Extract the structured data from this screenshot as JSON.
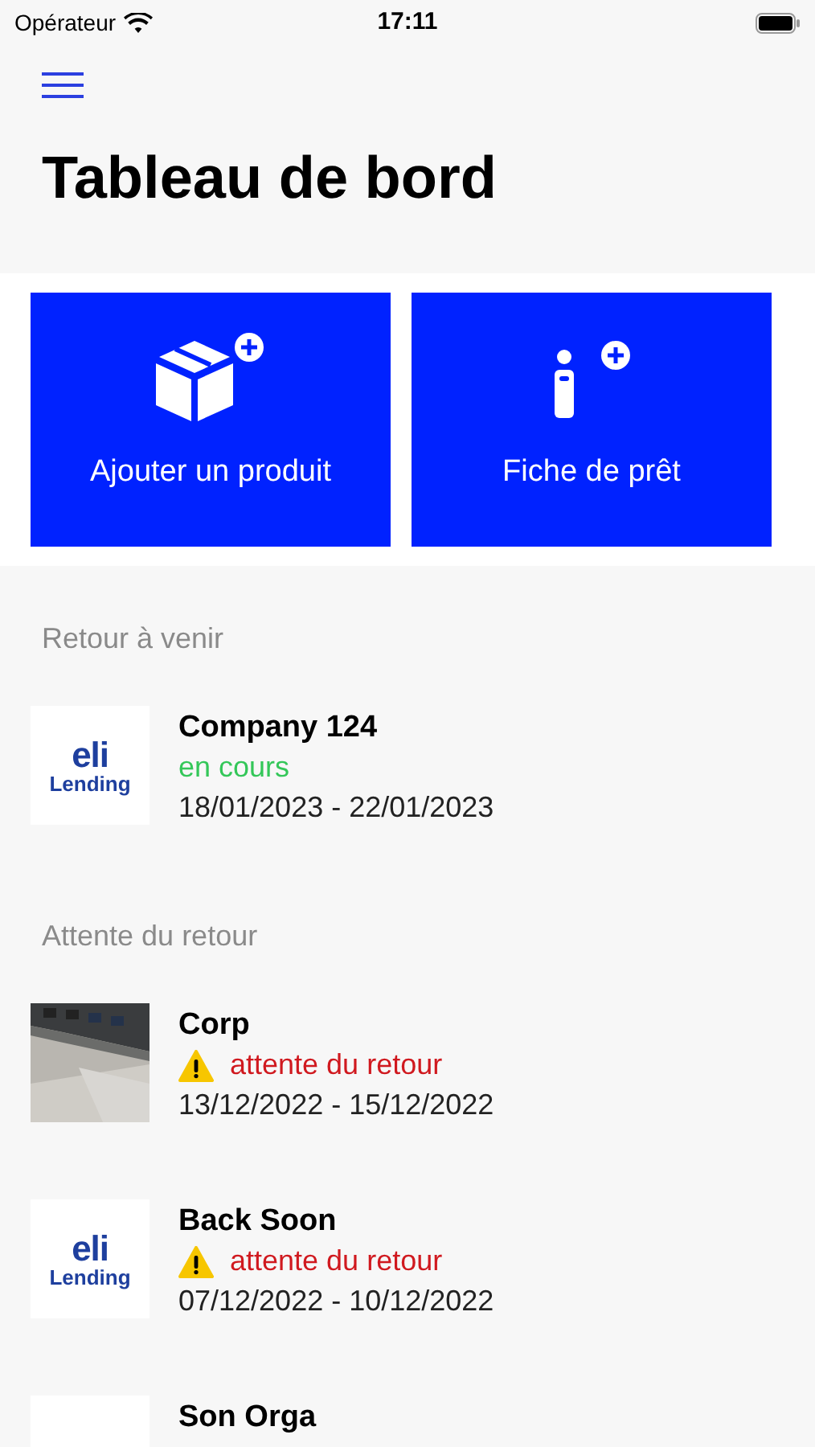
{
  "status_bar": {
    "carrier": "Opérateur",
    "time": "17:11"
  },
  "title": "Tableau de bord",
  "actions": [
    {
      "kind": "product",
      "label": "Ajouter un produit"
    },
    {
      "kind": "loan",
      "label": "Fiche de prêt"
    }
  ],
  "sections": [
    {
      "header": "Retour à venir",
      "items": [
        {
          "thumbnail": {
            "kind": "logo",
            "line_1": "eli",
            "line_2": "Lending"
          },
          "name": "Company 124",
          "status": {
            "kind": "active",
            "text": "en cours"
          },
          "dates": "18/01/2023 - 22/01/2023"
        }
      ]
    },
    {
      "header": "Attente du retour",
      "items": [
        {
          "name": "Corp",
          "status": {
            "kind": "waiting",
            "text": "attente du retour"
          },
          "dates": "13/12/2022 - 15/12/2022"
        },
        {
          "thumbnail": {
            "kind": "logo",
            "line_1": "eli",
            "line_2": "Lending"
          },
          "name": "Back Soon",
          "status": {
            "kind": "waiting",
            "text": "attente du retour"
          },
          "dates": "07/12/2022 - 10/12/2022"
        },
        {
          "thumbnail": {
            "kind": "blank"
          },
          "name": "Son Orga"
        }
      ]
    }
  ]
}
